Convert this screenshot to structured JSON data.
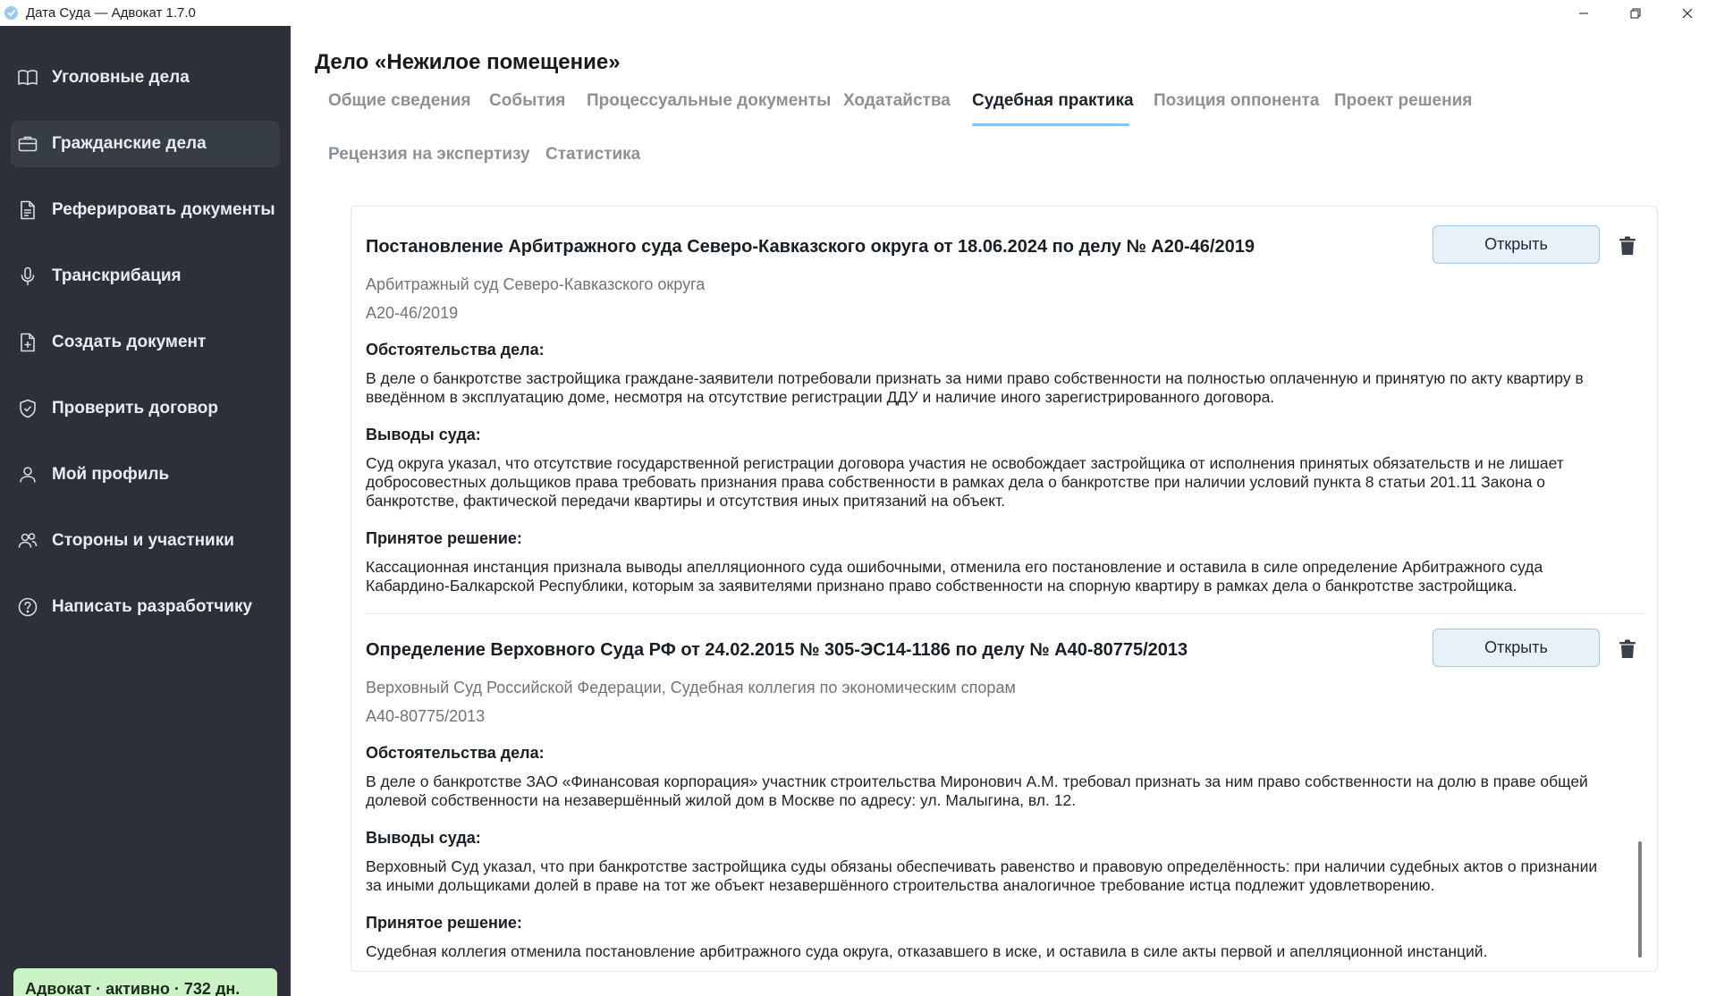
{
  "window": {
    "title": "Дата Суда — Адвокат 1.7.0"
  },
  "sidebar": {
    "items": [
      {
        "label": "Уголовные дела",
        "icon": "book-icon"
      },
      {
        "label": "Гражданские дела",
        "icon": "briefcase-icon",
        "active": true
      },
      {
        "label": "Реферировать документы",
        "icon": "document-icon"
      },
      {
        "label": "Транскрибация",
        "icon": "microphone-icon"
      },
      {
        "label": "Создать документ",
        "icon": "file-plus-icon"
      },
      {
        "label": "Проверить договор",
        "icon": "shield-check-icon"
      },
      {
        "label": "Мой профиль",
        "icon": "user-icon"
      },
      {
        "label": "Стороны и участники",
        "icon": "users-icon"
      },
      {
        "label": "Написать разработчику",
        "icon": "help-circle-icon"
      }
    ],
    "license_badge": "Адвокат · активно · 732 дн."
  },
  "main": {
    "case_title": "Дело «Нежилое помещение»",
    "tabs": [
      {
        "label": "Общие сведения"
      },
      {
        "label": "События"
      },
      {
        "label": "Процессуальные документы"
      },
      {
        "label": "Ходатайства"
      },
      {
        "label": "Судебная практика",
        "active": true
      },
      {
        "label": "Позиция оппонента"
      },
      {
        "label": "Проект решения"
      },
      {
        "label": "Рецензия на экспертизу"
      },
      {
        "label": "Статистика"
      }
    ],
    "entries": [
      {
        "title": "Постановление Арбитражного суда Северо-Кавказского округа от 18.06.2024 по делу № А20-46/2019",
        "court": "Арбитражный суд Северо-Кавказского округа",
        "case_number": "А20-46/2019",
        "open_label": "Открыть",
        "circumstances_heading": "Обстоятельства дела:",
        "circumstances_text": "В деле о банкротстве застройщика граждане-заявители потребовали признать за ними право собственности на полностью оплаченную и принятую по акту квартиру в введённом в эксплуатацию доме, несмотря на отсутствие регистрации ДДУ и наличие иного зарегистрированного договора.",
        "conclusions_heading": "Выводы суда:",
        "conclusions_text": "Суд округа указал, что отсутствие государственной регистрации договора участия не освобождает застройщика от исполнения принятых обязательств и не лишает добросовестных дольщиков права требовать признания права собственности в рамках дела о банкротстве при наличии условий пункта 8 статьи 201.11 Закона о банкротстве, фактической передачи квартиры и отсутствия иных притязаний на объект.",
        "decision_heading": "Принятое решение:",
        "decision_text": "Кассационная инстанция признала выводы апелляционного суда ошибочными, отменила его постановление и оставила в силе определение Арбитражного суда Кабардино-Балкарской Республики, которым за заявителями признано право собственности на спорную квартиру в рамках дела о банкротстве застройщика."
      },
      {
        "title": "Определение Верховного Суда РФ от 24.02.2015 № 305-ЭС14-1186 по делу № А40-80775/2013",
        "court": "Верховный Суд Российской Федерации, Судебная коллегия по экономическим спорам",
        "case_number": "А40-80775/2013",
        "open_label": "Открыть",
        "circumstances_heading": "Обстоятельства дела:",
        "circumstances_text": "В деле о банкротстве ЗАО «Финансовая корпорация» участник строительства Миронович А.М. требовал признать за ним право собственности на долю в праве общей долевой собственности на незавершённый жилой дом в Москве по адресу: ул. Малыгина, вл. 12.",
        "conclusions_heading": "Выводы суда:",
        "conclusions_text": "Верховный Суд указал, что при банкротстве застройщика суды обязаны обеспечивать равенство и правовую определённость: при наличии судебных актов о признании за иными дольщиками долей в праве на тот же объект незавершённого строительства аналогичное требование истца подлежит удовлетворению.",
        "decision_heading": "Принятое решение:",
        "decision_text": "Судебная коллегия отменила постановление арбитражного суда округа, отказавшего в иске, и оставила в силе акты первой и апелляционной инстанций."
      }
    ]
  }
}
